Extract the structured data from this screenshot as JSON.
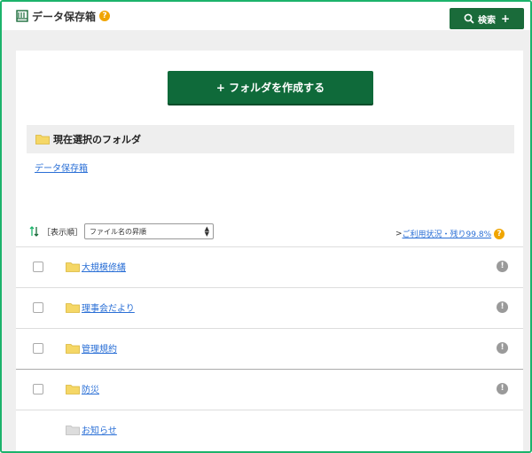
{
  "header": {
    "title": "データ保存箱",
    "help": "?"
  },
  "search": {
    "label": "検索",
    "plus": "+"
  },
  "create_folder": {
    "label": "+ フォルダを作成する"
  },
  "selection": {
    "label": "現在選択のフォルダ"
  },
  "breadcrumb": {
    "label": "データ保存箱"
  },
  "sort": {
    "label": "［表示順］",
    "selected": "ファイル名の昇順"
  },
  "usage": {
    "prefix": ">",
    "link": "ご利用状況・残り99.8%",
    "help": "?"
  },
  "folders": [
    {
      "name": "大規模修繕",
      "info": "!"
    },
    {
      "name": "理事会だより",
      "info": "!"
    },
    {
      "name": "管理規約",
      "info": "!"
    },
    {
      "name": "防災",
      "info": "!"
    },
    {
      "name": "お知らせ"
    }
  ],
  "colors": {
    "accent": "#1a6b3a",
    "border": "#1cb36b",
    "link": "#2a6fd6",
    "help": "#f0a500",
    "folder": "#f5d766"
  }
}
